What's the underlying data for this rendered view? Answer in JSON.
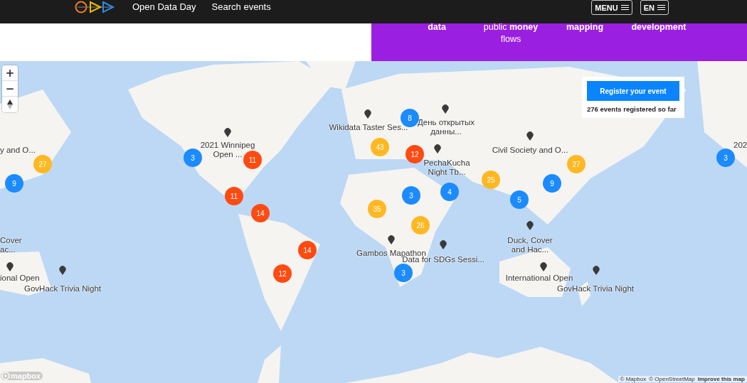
{
  "header": {
    "nav": [
      "Open Data Day",
      "Search events"
    ],
    "menu_button": "MENU",
    "language_button": "EN"
  },
  "banner": {
    "items": [
      "**data**",
      "public **money** flows",
      "**mapping**",
      "**development**"
    ]
  },
  "map": {
    "zoom_controls": [
      "+",
      "−"
    ],
    "register": {
      "button": "Register your event",
      "count_text": "276 events registered so far"
    },
    "clusters": [
      {
        "count": "27",
        "color": "#ffb822"
      },
      {
        "count": "9",
        "color": "#1b8bff"
      },
      {
        "count": "3",
        "color": "#1b8bff"
      },
      {
        "count": "11",
        "color": "#ff4b12"
      },
      {
        "count": "11",
        "color": "#ff4b12"
      },
      {
        "count": "14",
        "color": "#ff4b12"
      },
      {
        "count": "14",
        "color": "#ff4b12"
      },
      {
        "count": "12",
        "color": "#ff4b12"
      },
      {
        "count": "8",
        "color": "#1b8bff"
      },
      {
        "count": "43",
        "color": "#ffb822"
      },
      {
        "count": "12",
        "color": "#ff4b12"
      },
      {
        "count": "3",
        "color": "#1b8bff"
      },
      {
        "count": "4",
        "color": "#1b8bff"
      },
      {
        "count": "35",
        "color": "#ffb822"
      },
      {
        "count": "26",
        "color": "#ffb822"
      },
      {
        "count": "3",
        "color": "#1b8bff"
      },
      {
        "count": "25",
        "color": "#ffb822"
      },
      {
        "count": "5",
        "color": "#1b8bff"
      },
      {
        "count": "9",
        "color": "#1b8bff"
      },
      {
        "count": "27",
        "color": "#ffb822"
      },
      {
        "count": "3",
        "color": "#1b8bff"
      }
    ],
    "events": [
      {
        "label": "y and O...",
        "pin": false
      },
      {
        "label": "Cover\nac...",
        "pin": false
      },
      {
        "label": "ional Open",
        "pin": true
      },
      {
        "label": "GovHack Trivia Night",
        "pin": true
      },
      {
        "label": "2021 Winnipeg\nOpen ...",
        "pin": true
      },
      {
        "label": "Wikidata Taster Ses...",
        "pin": true
      },
      {
        "label": "День открытых\nданны...",
        "pin": true
      },
      {
        "label": "PechaKucha\nNight Tb...",
        "pin": true
      },
      {
        "label": "Civil Society and O...",
        "pin": true
      },
      {
        "label": "Gambos Mapathon",
        "pin": true
      },
      {
        "label": "Data for SDGs Sessi...",
        "pin": true
      },
      {
        "label": "Duck, Cover\nand Hac...",
        "pin": true
      },
      {
        "label": "International Open",
        "pin": true
      },
      {
        "label": "GovHack Trivia Night",
        "pin": true
      },
      {
        "label": "202",
        "pin": false
      }
    ],
    "logo": "mapbox",
    "attribution": [
      "© Mapbox",
      "© OpenStreetMap",
      "Improve this map"
    ]
  }
}
